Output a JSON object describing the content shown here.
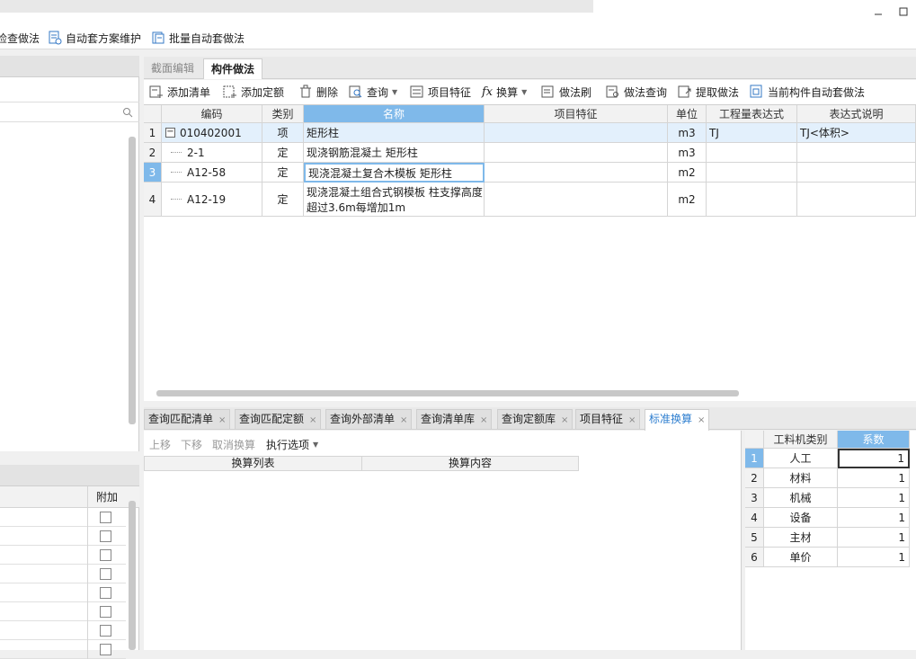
{
  "toolbar1": {
    "items": [
      {
        "label": "检查做法"
      },
      {
        "label": "自动套方案维护"
      },
      {
        "label": "批量自动套做法"
      }
    ]
  },
  "left_panel2": {
    "header": "附加"
  },
  "tabs_top": [
    "截面编辑",
    "构件做法"
  ],
  "toolbar2": [
    {
      "label": "添加清单"
    },
    {
      "label": "添加定额"
    },
    {
      "label": "删除"
    },
    {
      "label": "查询"
    },
    {
      "label": "项目特征"
    },
    {
      "label": "换算"
    },
    {
      "label": "做法刷"
    },
    {
      "label": "做法查询"
    },
    {
      "label": "提取做法"
    },
    {
      "label": "当前构件自动套做法"
    }
  ],
  "grid": {
    "columns": [
      "编码",
      "类别",
      "名称",
      "项目特征",
      "单位",
      "工程量表达式",
      "表达式说明"
    ],
    "rows": [
      {
        "num": "1",
        "code": "010402001",
        "type": "项",
        "name": "矩形柱",
        "name2": "",
        "feature": "",
        "unit": "m3",
        "expr": "TJ",
        "desc": "TJ<体积>"
      },
      {
        "num": "2",
        "code": "2-1",
        "type": "定",
        "name": "现浇钢筋混凝土 矩形柱",
        "name2": "",
        "feature": "",
        "unit": "m3",
        "expr": "",
        "desc": ""
      },
      {
        "num": "3",
        "code": "A12-58",
        "type": "定",
        "name": "现浇混凝土复合木模板 矩形柱",
        "name2": "",
        "feature": "",
        "unit": "m2",
        "expr": "",
        "desc": ""
      },
      {
        "num": "4",
        "code": "A12-19",
        "type": "定",
        "name": "现浇混凝土组合式钢模板 柱支撑高度",
        "name2": "超过3.6m每增加1m",
        "feature": "",
        "unit": "m2",
        "expr": "",
        "desc": ""
      }
    ]
  },
  "tabs_bottom": [
    "查询匹配清单",
    "查询匹配定额",
    "查询外部清单",
    "查询清单库",
    "查询定额库",
    "项目特征",
    "标准换算"
  ],
  "bottom_left": {
    "actions": [
      "上移",
      "下移",
      "取消换算",
      "执行选项"
    ],
    "columns": [
      "换算列表",
      "换算内容"
    ]
  },
  "bottom_right": {
    "columns": [
      "工料机类别",
      "系数"
    ],
    "rows": [
      {
        "num": "1",
        "cat": "人工",
        "coef": "1"
      },
      {
        "num": "2",
        "cat": "材料",
        "coef": "1"
      },
      {
        "num": "3",
        "cat": "机械",
        "coef": "1"
      },
      {
        "num": "4",
        "cat": "设备",
        "coef": "1"
      },
      {
        "num": "5",
        "cat": "主材",
        "coef": "1"
      },
      {
        "num": "6",
        "cat": "单价",
        "coef": "1"
      }
    ]
  },
  "colors": {
    "accent": "#2f7fd0",
    "header_selected": "#7fb9ea",
    "row_selected": "#e3f0fc"
  }
}
